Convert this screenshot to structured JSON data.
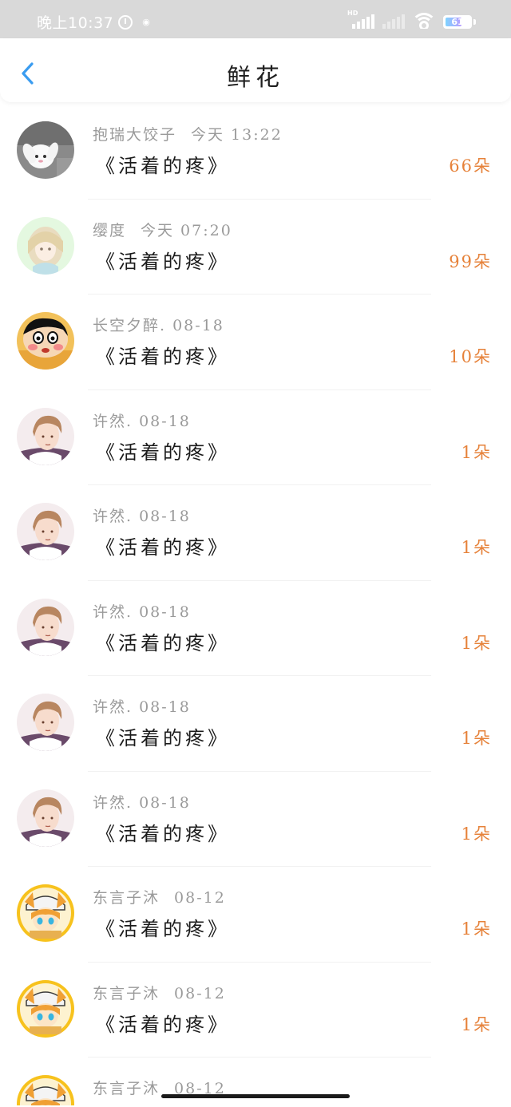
{
  "status_bar": {
    "time": "晚上10:37",
    "network_label": "HD",
    "battery": "61",
    "battery_level": 0.61
  },
  "header": {
    "title": "鲜花",
    "back_icon": "chevron-left-icon",
    "accent_color": "#3a9cf0"
  },
  "colors": {
    "count": "#e6823a",
    "meta": "#9a9a9a"
  },
  "rows": [
    {
      "name": "抱瑞大饺子",
      "time": "今天 13:22",
      "book": "《活着的疼》",
      "count": "66朵",
      "avatar": "bunny"
    },
    {
      "name": "缨度",
      "time": "今天 07:20",
      "book": "《活着的疼》",
      "count": "99朵",
      "avatar": "girl"
    },
    {
      "name": "长空夕醉",
      "time": ". 08-18",
      "book": "《活着的疼》",
      "count": "10朵",
      "avatar": "cartoon-boy"
    },
    {
      "name": "许然",
      "time": ". 08-18",
      "book": "《活着的疼》",
      "count": "1朵",
      "avatar": "man"
    },
    {
      "name": "许然",
      "time": ". 08-18",
      "book": "《活着的疼》",
      "count": "1朵",
      "avatar": "man"
    },
    {
      "name": "许然",
      "time": ". 08-18",
      "book": "《活着的疼》",
      "count": "1朵",
      "avatar": "man"
    },
    {
      "name": "许然",
      "time": ". 08-18",
      "book": "《活着的疼》",
      "count": "1朵",
      "avatar": "man"
    },
    {
      "name": "许然",
      "time": ". 08-18",
      "book": "《活着的疼》",
      "count": "1朵",
      "avatar": "man"
    },
    {
      "name": "东言子沐",
      "time": "08-12",
      "book": "《活着的疼》",
      "count": "1朵",
      "avatar": "fox"
    },
    {
      "name": "东言子沐",
      "time": "08-12",
      "book": "《活着的疼》",
      "count": "1朵",
      "avatar": "fox"
    },
    {
      "name": "东言子沐",
      "time": "08-12",
      "book": "",
      "count": "",
      "avatar": "fox"
    }
  ]
}
